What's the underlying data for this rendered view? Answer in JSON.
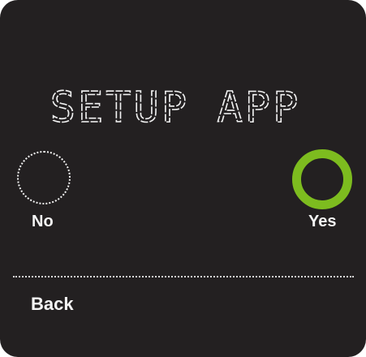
{
  "screen": {
    "title": "SETUP APP"
  },
  "choices": {
    "no": {
      "label": "No",
      "selected": false
    },
    "yes": {
      "label": "Yes",
      "selected": true
    }
  },
  "footer": {
    "back_label": "Back"
  },
  "colors": {
    "background": "#232021",
    "accent": "#7dbc1f",
    "text": "#f4f4f4"
  }
}
